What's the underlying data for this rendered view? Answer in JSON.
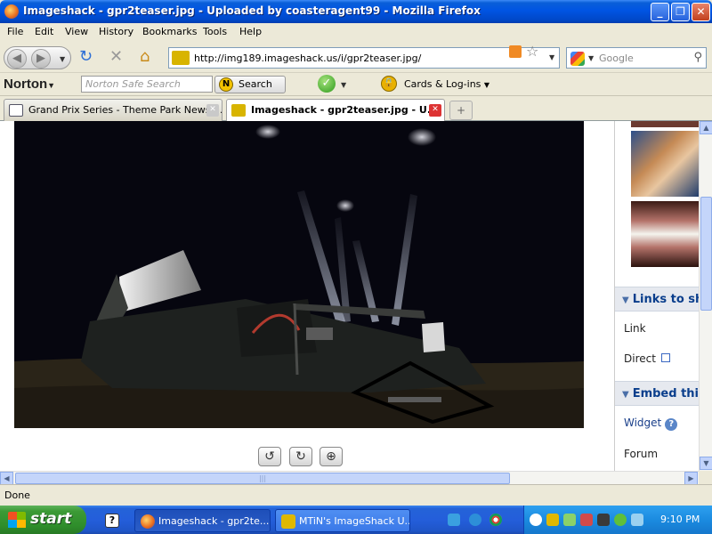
{
  "window": {
    "title": "Imageshack - gpr2teaser.jpg - Uploaded by coasteragent99 - Mozilla Firefox",
    "minimize": "_",
    "maximize": "❐",
    "close": "✕"
  },
  "menu": [
    "File",
    "Edit",
    "View",
    "History",
    "Bookmarks",
    "Tools",
    "Help"
  ],
  "nav": {
    "url": "http://img189.imageshack.us/i/gpr2teaser.jpg/",
    "search_placeholder": "Google"
  },
  "norton": {
    "logo": "Norton",
    "search_placeholder": "Norton Safe Search",
    "search_button": "Search",
    "cards_label": "Cards & Log-ins"
  },
  "tabs": [
    {
      "label": "Grand Prix Series - Theme Park News, ...",
      "active": false
    },
    {
      "label": "Imageshack - gpr2teaser.jpg - U...",
      "active": true
    }
  ],
  "sidebar": {
    "links_heading": "Links to sh",
    "link_label": "Link",
    "direct_label": "Direct",
    "embed_heading": "Embed thi",
    "widget_label": "Widget",
    "forum_label": "Forum"
  },
  "status": {
    "text": "Done"
  },
  "taskbar": {
    "start_label": "start",
    "buttons": [
      {
        "label": "Imageshack - gpr2te...",
        "active": true
      },
      {
        "label": "MTiN's ImageShack U...",
        "active": false
      }
    ],
    "clock": "9:10 PM"
  }
}
